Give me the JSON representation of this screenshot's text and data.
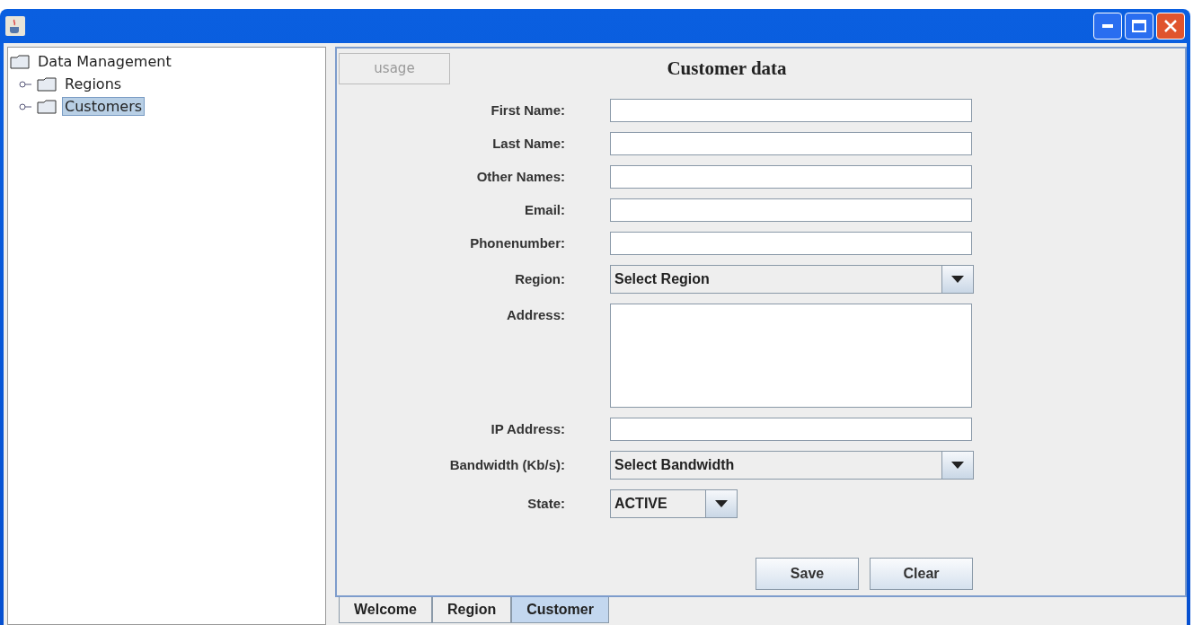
{
  "tree": {
    "label": "Data Management",
    "children": [
      {
        "label": "Regions",
        "selected": false
      },
      {
        "label": "Customers",
        "selected": true
      }
    ]
  },
  "usage_button": {
    "label": "usage",
    "disabled": true
  },
  "form_title": "Customer data",
  "fields": [
    {
      "kind": "text",
      "label": "First Name:"
    },
    {
      "kind": "text",
      "label": "Last Name:"
    },
    {
      "kind": "text",
      "label": "Other Names:"
    },
    {
      "kind": "text",
      "label": "Email:"
    },
    {
      "kind": "text",
      "label": "Phonenumber:"
    },
    {
      "kind": "select",
      "label": "Region:",
      "value": "Select Region"
    },
    {
      "kind": "textarea",
      "label": "Address:"
    },
    {
      "kind": "text",
      "label": "IP Address:"
    },
    {
      "kind": "select",
      "label": "Bandwidth (Kb/s):",
      "value": "Select Bandwidth"
    },
    {
      "kind": "small-select",
      "label": "State:",
      "value": "ACTIVE"
    }
  ],
  "buttons": [
    "Save",
    "Clear"
  ],
  "tabs": [
    {
      "label": "Welcome",
      "selected": false
    },
    {
      "label": "Region",
      "selected": false
    },
    {
      "label": "Customer",
      "selected": true
    }
  ]
}
